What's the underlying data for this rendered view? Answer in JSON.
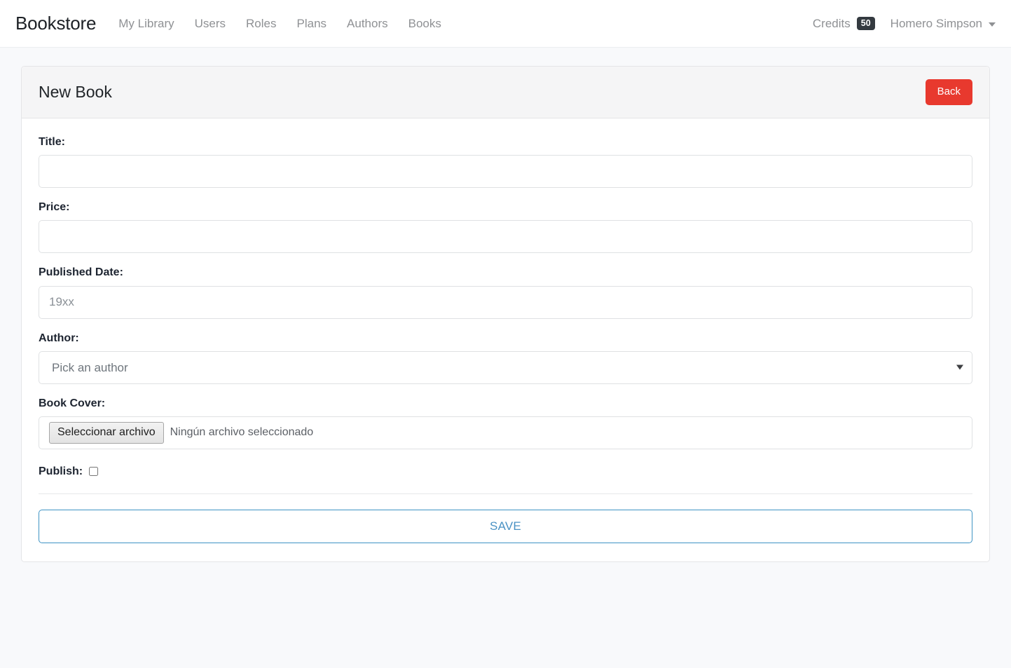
{
  "navbar": {
    "brand": "Bookstore",
    "links": [
      {
        "label": "My Library"
      },
      {
        "label": "Users"
      },
      {
        "label": "Roles"
      },
      {
        "label": "Plans"
      },
      {
        "label": "Authors"
      },
      {
        "label": "Books"
      }
    ],
    "credits": {
      "label": "Credits",
      "count": "50"
    },
    "user": {
      "name": "Homero Simpson"
    }
  },
  "card": {
    "title": "New Book",
    "back_button": "Back"
  },
  "form": {
    "title": {
      "label": "Title:",
      "value": "",
      "placeholder": ""
    },
    "price": {
      "label": "Price:",
      "value": "",
      "placeholder": ""
    },
    "published_date": {
      "label": "Published Date:",
      "value": "",
      "placeholder": "19xx"
    },
    "author": {
      "label": "Author:",
      "selected": "Pick an author",
      "options": [
        "Pick an author"
      ]
    },
    "book_cover": {
      "label": "Book Cover:",
      "button": "Seleccionar archivo",
      "file_status": "Ningún archivo seleccionado"
    },
    "publish": {
      "label": "Publish:",
      "checked": false
    },
    "save_button": "SAVE"
  },
  "colors": {
    "danger": "#e8392e",
    "info": "#4a92c4",
    "badge_dark": "#343a40",
    "page_bg": "#f8f9fb"
  }
}
